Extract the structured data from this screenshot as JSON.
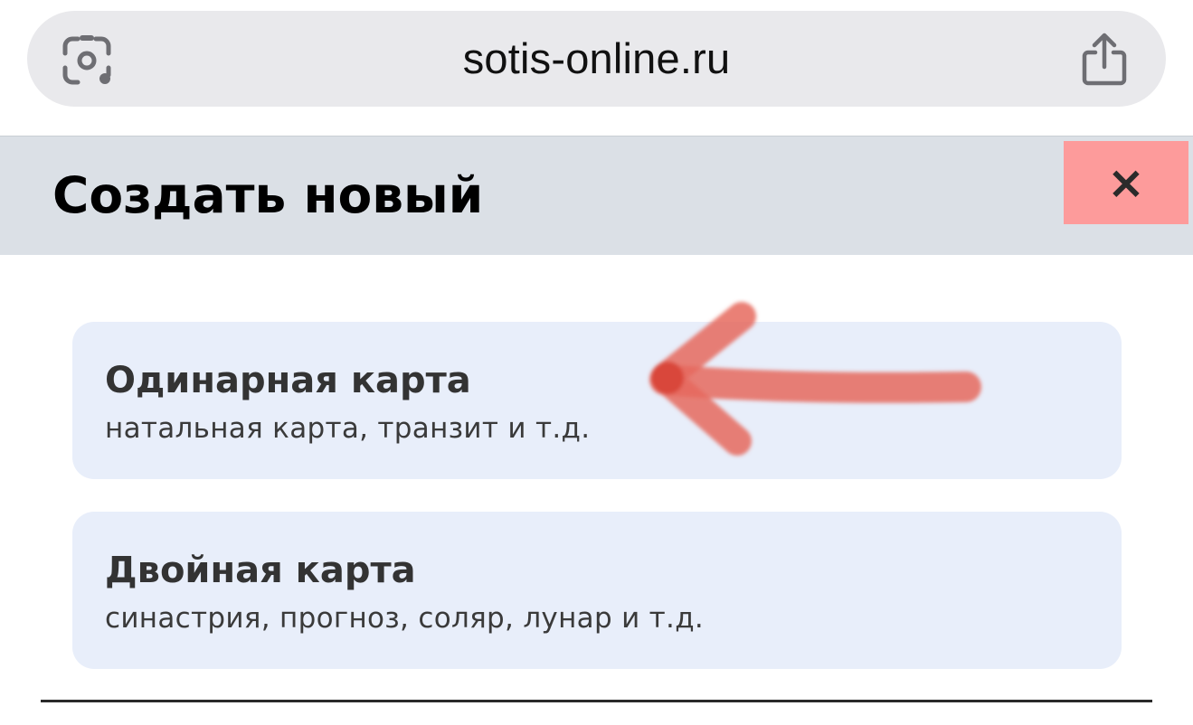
{
  "browser": {
    "url": "sotis-online.ru",
    "left_icon": "visual-lookup-icon",
    "right_icon": "share-icon"
  },
  "dialog": {
    "title": "Создать новый",
    "close_label": "×",
    "header_color": "#dbe0e6",
    "close_color": "#fd9b9b"
  },
  "options": [
    {
      "title": "Одинарная карта",
      "subtitle": "натальная карта, транзит и т.д."
    },
    {
      "title": "Двойная карта",
      "subtitle": "синастрия, прогноз, соляр, лунар и т.д."
    }
  ],
  "annotation": {
    "type": "hand-drawn-arrow",
    "points_to": "Одинарная карта",
    "color": "#e0503c"
  }
}
